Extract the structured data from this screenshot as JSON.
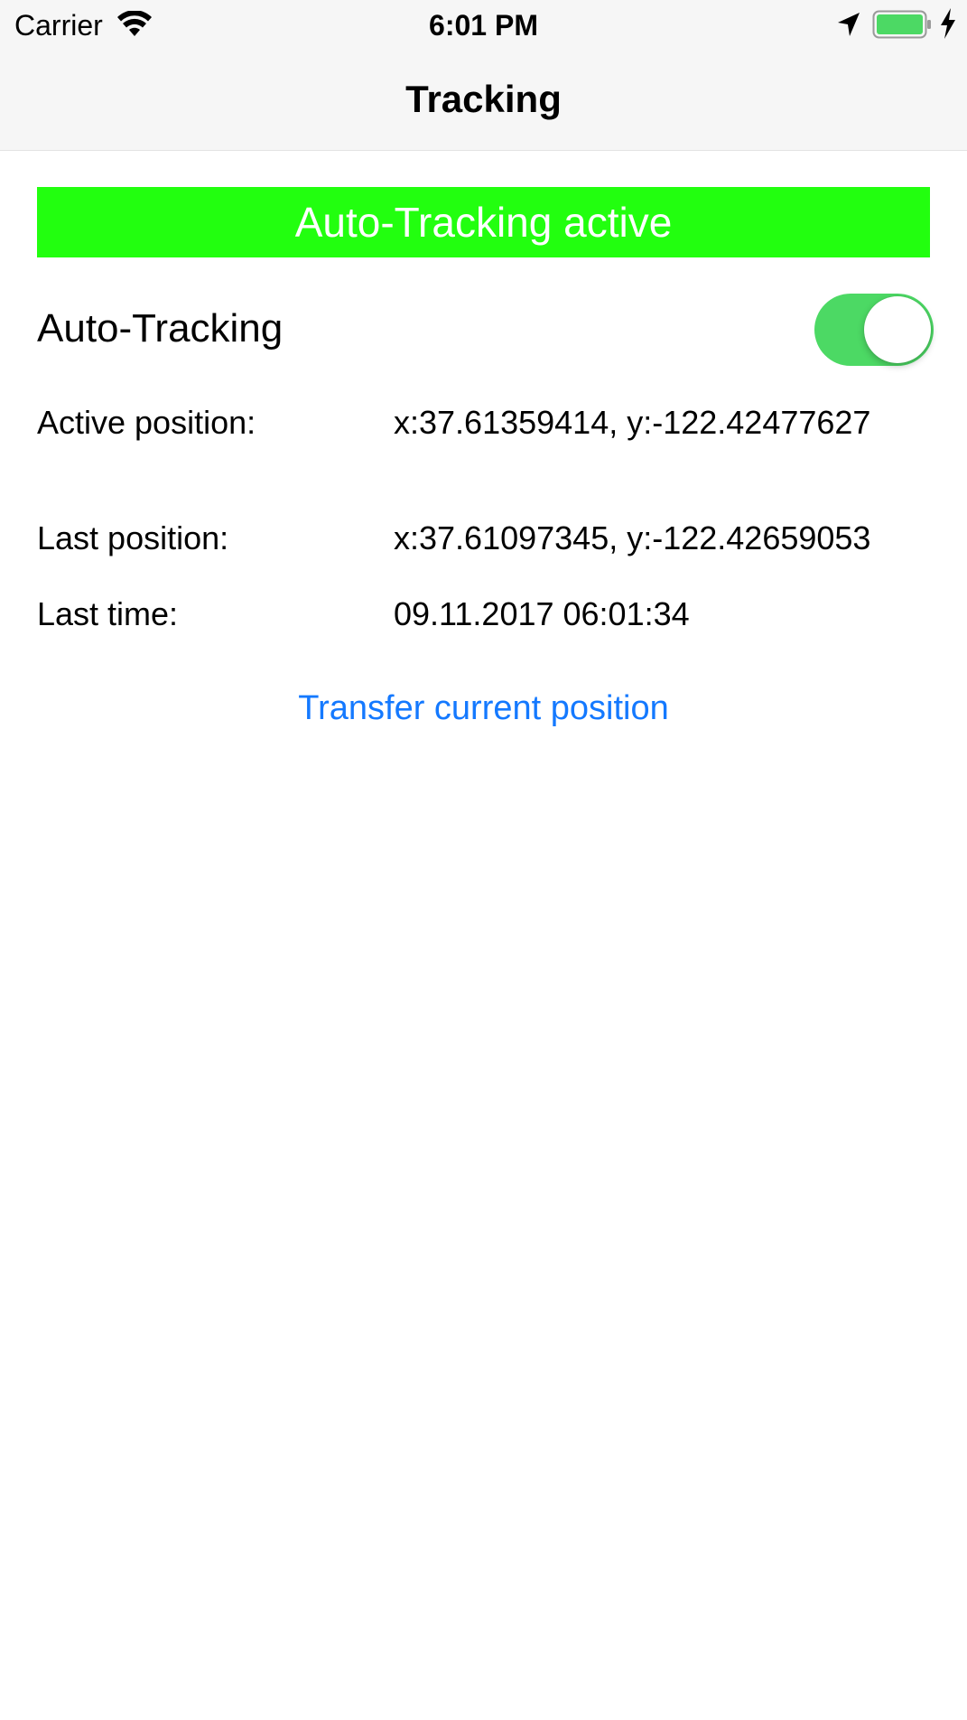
{
  "status_bar": {
    "carrier": "Carrier",
    "time": "6:01 PM",
    "icons": [
      "wifi-icon",
      "location-arrow-icon",
      "battery-icon",
      "charging-bolt-icon"
    ],
    "battery_color": "#4cd964"
  },
  "nav": {
    "title": "Tracking"
  },
  "banner": {
    "text": "Auto-Tracking active",
    "background": "#22ff0f",
    "text_color": "#ffffff"
  },
  "auto_tracking": {
    "label": "Auto-Tracking",
    "enabled": true,
    "switch_color": "#4cd964"
  },
  "info": {
    "active_position_label": "Active position:",
    "active_position_value": "x:37.61359414, y:-122.42477627",
    "last_position_label": "Last position:",
    "last_position_value": "x:37.61097345, y:-122.42659053",
    "last_time_label": "Last time:",
    "last_time_value": "09.11.2017 06:01:34"
  },
  "actions": {
    "transfer_label": "Transfer current position",
    "link_color": "#1479ff"
  }
}
